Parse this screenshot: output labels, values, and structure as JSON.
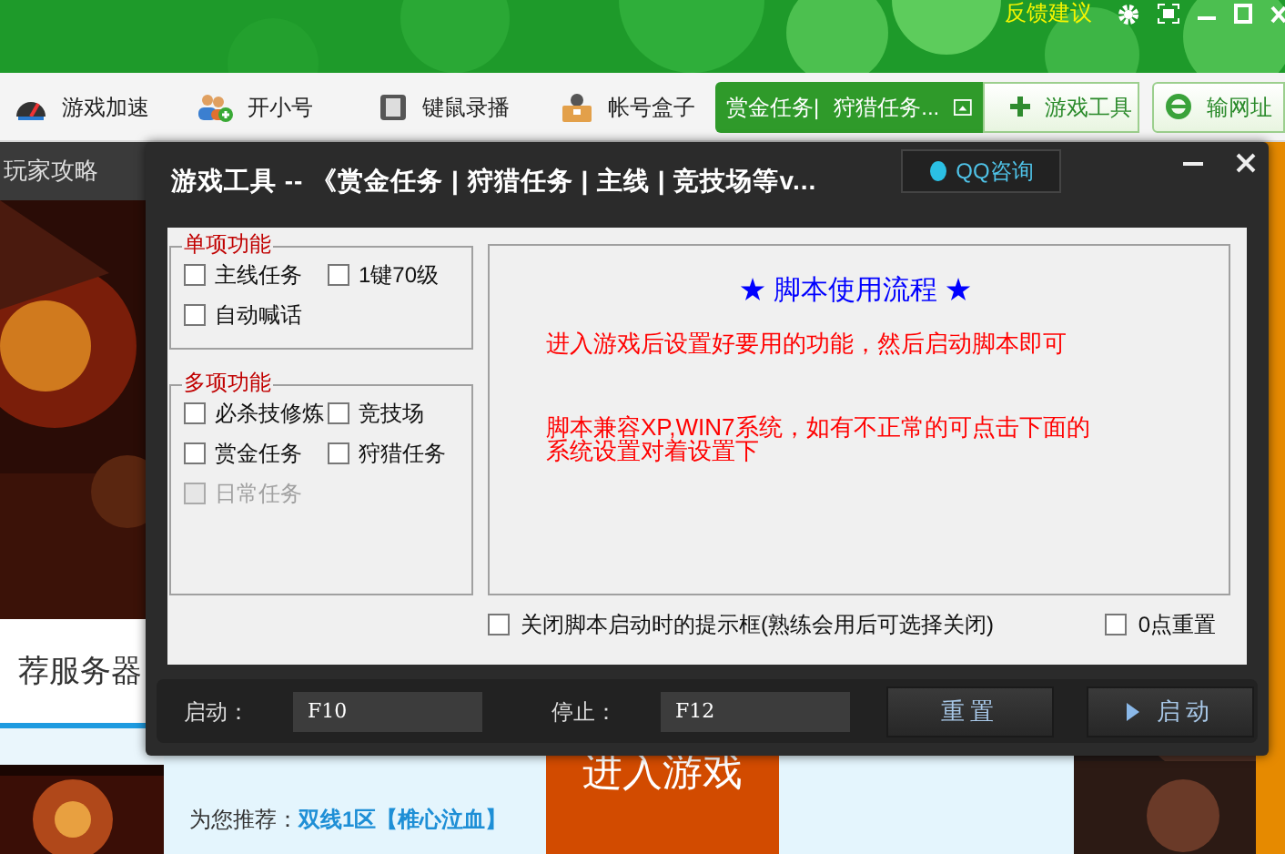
{
  "header": {
    "feedback": "反馈建议"
  },
  "toolbar": {
    "tools": [
      {
        "label": "游戏加速",
        "kind": "speed"
      },
      {
        "label": "开小号",
        "kind": "users"
      },
      {
        "label": "键鼠录播",
        "kind": "record"
      },
      {
        "label": "帐号盒子",
        "kind": "box"
      }
    ],
    "task_tabs": [
      "赏金任务|",
      "狩猎任务..."
    ],
    "buttons": [
      {
        "label": "游戏工具",
        "kind": "plus"
      },
      {
        "label": "输网址",
        "kind": "browser"
      }
    ]
  },
  "background": {
    "sidebar_label": "玩家攻略",
    "server_heading": "荐服务器",
    "recommend_label": "为您推荐：",
    "recommend_server": "双线1区【椎心泣血】",
    "enter_button": "进入游戏"
  },
  "dialog": {
    "title": "游戏工具 -- 《赏金任务 | 狩猎任务 | 主线 | 竞技场等v...",
    "qq_button": "QQ咨询",
    "groups": [
      {
        "title": "单项功能",
        "options": [
          {
            "label": "主线任务",
            "checked": false,
            "disabled": false
          },
          {
            "label": "1键70级",
            "checked": false,
            "disabled": false
          },
          {
            "label": "自动喊话",
            "checked": false,
            "disabled": false
          }
        ]
      },
      {
        "title": "多项功能",
        "options": [
          {
            "label": "必杀技修炼",
            "checked": false,
            "disabled": false
          },
          {
            "label": "竞技场",
            "checked": false,
            "disabled": false
          },
          {
            "label": "赏金任务",
            "checked": false,
            "disabled": false
          },
          {
            "label": "狩猎任务",
            "checked": false,
            "disabled": false
          },
          {
            "label": "日常任务",
            "checked": false,
            "disabled": true
          }
        ]
      }
    ],
    "info": {
      "heading": "★ 脚本使用流程 ★",
      "paragraphs": [
        "进入游戏后设置好要用的功能，然后启动脚本即可",
        "脚本兼容XP,WIN7系统，如有不正常的可点击下面的系统设置对着设置下"
      ]
    },
    "bottom_options": [
      {
        "label": "关闭脚本启动时的提示框(熟练会用后可选择关闭)",
        "checked": false
      },
      {
        "label": "0点重置",
        "checked": false
      }
    ],
    "hotkeys": [
      {
        "label": "启动：",
        "value": "F10"
      },
      {
        "label": "停止：",
        "value": "F12"
      }
    ],
    "buttons": [
      {
        "label": "重置",
        "kind": "reset"
      },
      {
        "label": "启动",
        "kind": "start"
      }
    ]
  }
}
